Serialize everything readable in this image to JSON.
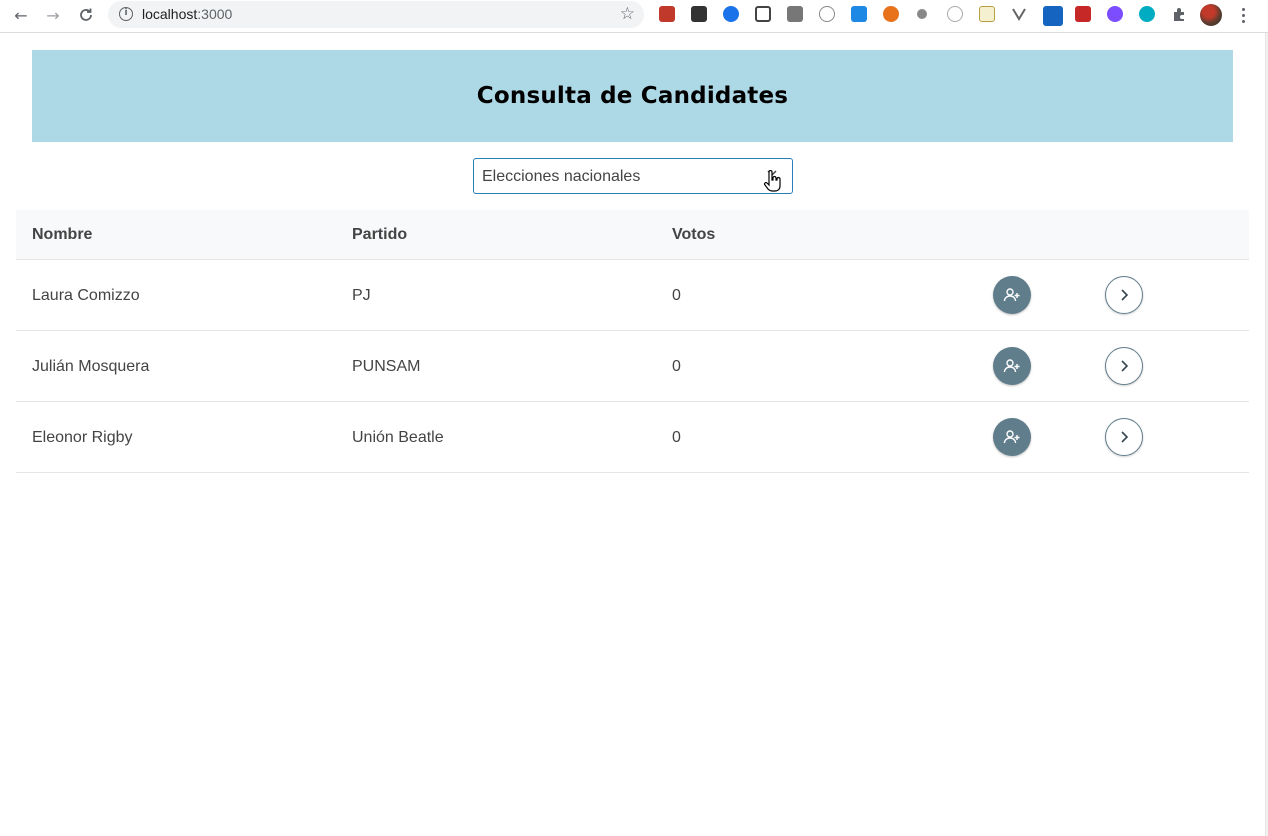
{
  "browser": {
    "url_host": "localhost",
    "url_port": ":3000"
  },
  "page": {
    "title": "Consulta de Candidates"
  },
  "election_select": {
    "value": "Elecciones nacionales"
  },
  "table": {
    "headers": {
      "name": "Nombre",
      "party": "Partido",
      "votes": "Votos"
    },
    "rows": [
      {
        "name": "Laura Comizzo",
        "party": "PJ",
        "votes": "0"
      },
      {
        "name": "Julián Mosquera",
        "party": "PUNSAM",
        "votes": "0"
      },
      {
        "name": "Eleonor Rigby",
        "party": "Unión Beatle",
        "votes": "0"
      }
    ]
  },
  "colors": {
    "header_band": "#add8e6",
    "action_button": "#607d8b",
    "select_border": "#2a7fb8"
  },
  "icons": {
    "vote_button": "user-plus-icon",
    "detail_button": "chevron-right-icon",
    "select": "chevron-down-icon"
  }
}
